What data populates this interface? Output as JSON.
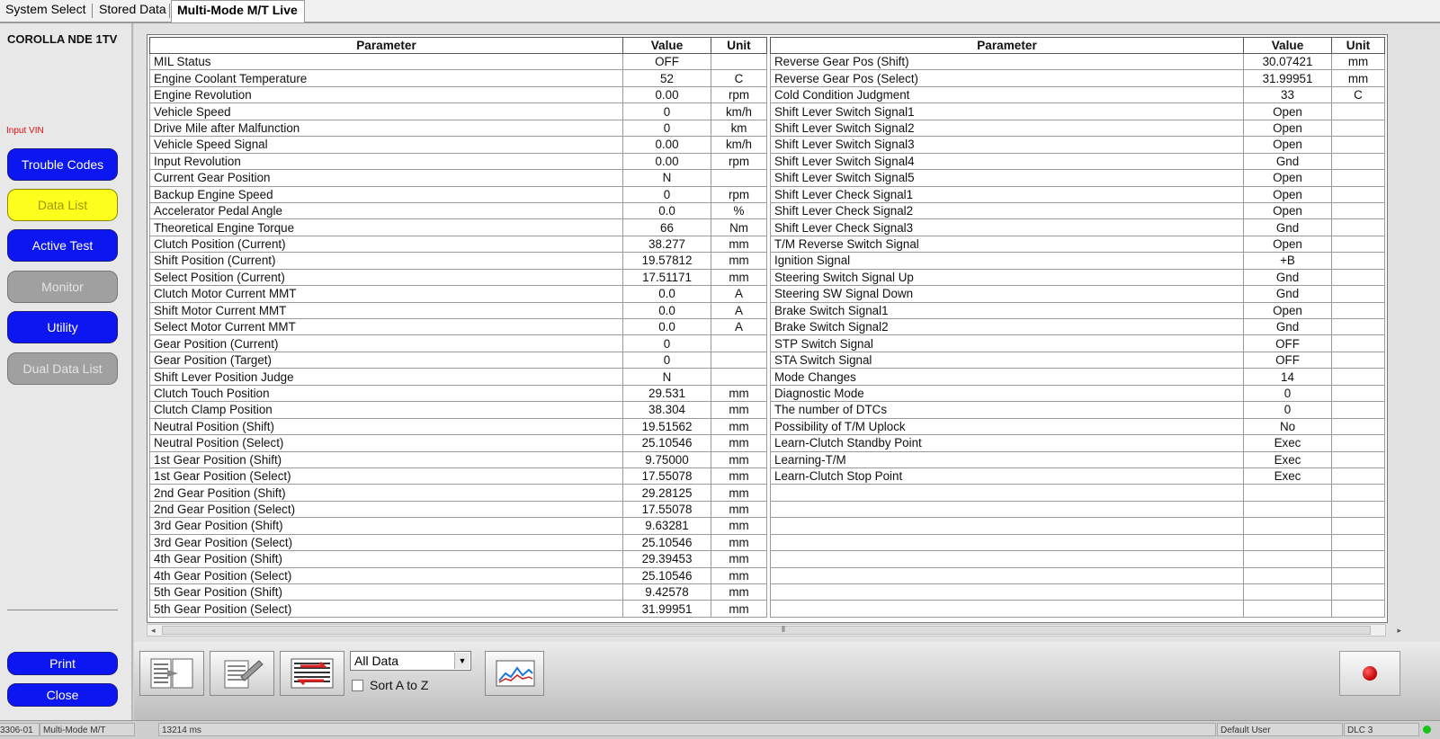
{
  "tabs": [
    {
      "label": "System Select"
    },
    {
      "label": "Stored Data"
    },
    {
      "label": "Multi-Mode M/T Live",
      "active": true
    }
  ],
  "sidebar": {
    "vehicle": "COROLLA NDE 1TV",
    "input_vin": "Input VIN",
    "buttons": [
      {
        "label": "Trouble Codes",
        "style": "blue"
      },
      {
        "label": "Data List",
        "style": "yellow"
      },
      {
        "label": "Active Test",
        "style": "blue"
      },
      {
        "label": "Monitor",
        "style": "gray"
      },
      {
        "label": "Utility",
        "style": "blue"
      },
      {
        "label": "Dual Data List",
        "style": "gray"
      }
    ],
    "print_label": "Print",
    "close_label": "Close"
  },
  "table": {
    "headers": {
      "parameter": "Parameter",
      "value": "Value",
      "unit": "Unit"
    },
    "left_rows": [
      [
        "MIL Status",
        "OFF",
        ""
      ],
      [
        "Engine Coolant Temperature",
        "52",
        "C"
      ],
      [
        "Engine Revolution",
        "0.00",
        "rpm"
      ],
      [
        "Vehicle Speed",
        "0",
        "km/h"
      ],
      [
        "Drive Mile after Malfunction",
        "0",
        "km"
      ],
      [
        "Vehicle Speed Signal",
        "0.00",
        "km/h"
      ],
      [
        "Input Revolution",
        "0.00",
        "rpm"
      ],
      [
        "Current Gear Position",
        "N",
        ""
      ],
      [
        "Backup Engine Speed",
        "0",
        "rpm"
      ],
      [
        "Accelerator Pedal Angle",
        "0.0",
        "%"
      ],
      [
        "Theoretical Engine Torque",
        "66",
        "Nm"
      ],
      [
        "Clutch Position (Current)",
        "38.277",
        "mm"
      ],
      [
        "Shift Position (Current)",
        "19.57812",
        "mm"
      ],
      [
        "Select Position (Current)",
        "17.51171",
        "mm"
      ],
      [
        "Clutch Motor Current MMT",
        "0.0",
        "A"
      ],
      [
        "Shift Motor Current MMT",
        "0.0",
        "A"
      ],
      [
        "Select Motor Current MMT",
        "0.0",
        "A"
      ],
      [
        "Gear Position (Current)",
        "0",
        ""
      ],
      [
        "Gear Position (Target)",
        "0",
        ""
      ],
      [
        "Shift Lever Position Judge",
        "N",
        ""
      ],
      [
        "Clutch Touch Position",
        "29.531",
        "mm"
      ],
      [
        "Clutch Clamp Position",
        "38.304",
        "mm"
      ],
      [
        "Neutral Position (Shift)",
        "19.51562",
        "mm"
      ],
      [
        "Neutral Position (Select)",
        "25.10546",
        "mm"
      ],
      [
        "1st Gear Position (Shift)",
        "9.75000",
        "mm"
      ],
      [
        "1st Gear Position (Select)",
        "17.55078",
        "mm"
      ],
      [
        "2nd Gear Position (Shift)",
        "29.28125",
        "mm"
      ],
      [
        "2nd Gear Position (Select)",
        "17.55078",
        "mm"
      ],
      [
        "3rd Gear Position (Shift)",
        "9.63281",
        "mm"
      ],
      [
        "3rd Gear Position (Select)",
        "25.10546",
        "mm"
      ],
      [
        "4th Gear Position (Shift)",
        "29.39453",
        "mm"
      ],
      [
        "4th Gear Position (Select)",
        "25.10546",
        "mm"
      ],
      [
        "5th Gear Position (Shift)",
        "9.42578",
        "mm"
      ],
      [
        "5th Gear Position (Select)",
        "31.99951",
        "mm"
      ]
    ],
    "right_rows": [
      [
        "Reverse Gear Pos (Shift)",
        "30.07421",
        "mm"
      ],
      [
        "Reverse Gear Pos (Select)",
        "31.99951",
        "mm"
      ],
      [
        "Cold Condition Judgment",
        "33",
        "C"
      ],
      [
        "Shift Lever Switch Signal1",
        "Open",
        ""
      ],
      [
        "Shift Lever Switch Signal2",
        "Open",
        ""
      ],
      [
        "Shift Lever Switch Signal3",
        "Open",
        ""
      ],
      [
        "Shift Lever Switch Signal4",
        "Gnd",
        ""
      ],
      [
        "Shift Lever Switch Signal5",
        "Open",
        ""
      ],
      [
        "Shift Lever Check Signal1",
        "Open",
        ""
      ],
      [
        "Shift Lever Check Signal2",
        "Open",
        ""
      ],
      [
        "Shift Lever Check Signal3",
        "Gnd",
        ""
      ],
      [
        "T/M Reverse Switch Signal",
        "Open",
        ""
      ],
      [
        "Ignition Signal",
        "+B",
        ""
      ],
      [
        "Steering Switch Signal Up",
        "Gnd",
        ""
      ],
      [
        "Steering SW Signal Down",
        "Gnd",
        ""
      ],
      [
        "Brake Switch Signal1",
        "Open",
        ""
      ],
      [
        "Brake Switch Signal2",
        "Gnd",
        ""
      ],
      [
        "STP Switch Signal",
        "OFF",
        ""
      ],
      [
        "STA Switch Signal",
        "OFF",
        ""
      ],
      [
        "Mode Changes",
        "14",
        ""
      ],
      [
        "Diagnostic Mode",
        "0",
        ""
      ],
      [
        "The number of DTCs",
        "0",
        ""
      ],
      [
        "Possibility of T/M Uplock",
        "No",
        ""
      ],
      [
        "Learn-Clutch Standby Point",
        "Exec",
        ""
      ],
      [
        "Learning-T/M",
        "Exec",
        ""
      ],
      [
        "Learn-Clutch Stop Point",
        "Exec",
        ""
      ]
    ]
  },
  "toolbar": {
    "filter_selected": "All Data",
    "sort_label": "Sort A to Z",
    "sort_checked": false
  },
  "statusbar": {
    "code": "3306-01",
    "system": "Multi-Mode M/T",
    "elapsed": "13214 ms",
    "user": "Default User",
    "connection": "DLC 3"
  },
  "colors": {
    "button_blue": "#0b16f0",
    "button_yellow": "#ffff1e",
    "button_gray": "#a0a0a0",
    "vin_red": "#e01010",
    "status_green": "#19c419"
  }
}
